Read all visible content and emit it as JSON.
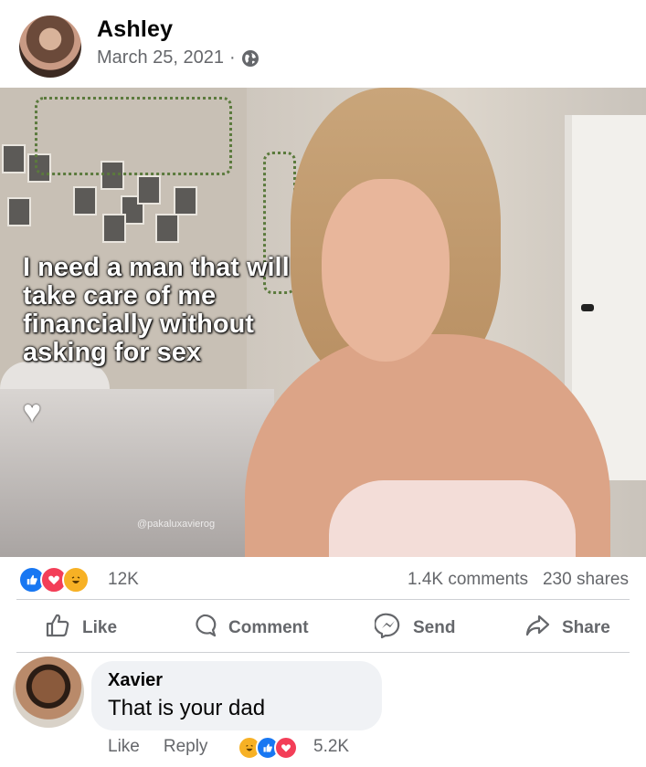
{
  "post": {
    "author": "Ashley",
    "date": "March 25, 2021",
    "separator": "·",
    "privacy_icon": "globe-icon",
    "image_overlay_text": "I need a man that will take care of me financially without asking for sex",
    "image_overlay_symbol": "♥",
    "watermark": "@pakaluxavierog"
  },
  "stats": {
    "reaction_icons": [
      "like-icon",
      "love-icon",
      "haha-icon"
    ],
    "reaction_count": "12K",
    "comments": "1.4K comments",
    "shares": "230 shares"
  },
  "actions": {
    "like": "Like",
    "comment": "Comment",
    "send": "Send",
    "share": "Share"
  },
  "comment": {
    "author": "Xavier",
    "text": "That is your dad",
    "like": "Like",
    "reply": "Reply",
    "reaction_icons": [
      "haha-icon",
      "like-icon",
      "love-icon"
    ],
    "reaction_count": "5.2K"
  },
  "colors": {
    "facebook_blue": "#1877f2",
    "love_red": "#f33e58",
    "haha_yellow": "#f7b125",
    "secondary_text": "#65676b"
  }
}
